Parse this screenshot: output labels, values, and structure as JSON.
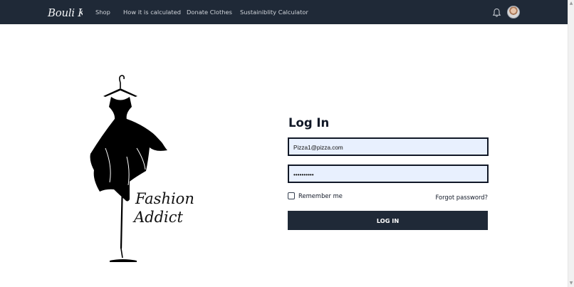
{
  "brand": {
    "logo_text": "Bouli K"
  },
  "nav": {
    "links": [
      "Shop",
      "How it is calculated",
      "Donate Clothes",
      "Sustainiblity Calculator"
    ],
    "icons": {
      "notifications": "bell-icon",
      "profile": "avatar"
    }
  },
  "illustration": {
    "text_line_1": "Fashion",
    "text_line_2": "Addict",
    "icon": "dress-on-hanger-icon"
  },
  "login": {
    "title": "Log In",
    "email_value": "Pizza1@pizza.com",
    "password_value": "••••••••••",
    "remember_label": "Remember me",
    "forgot_label": "Forgot password?",
    "submit_label": "LOG IN"
  },
  "colors": {
    "navbar": "#1f2937",
    "button": "#1f2937",
    "input_bg": "#e8f0fe"
  }
}
